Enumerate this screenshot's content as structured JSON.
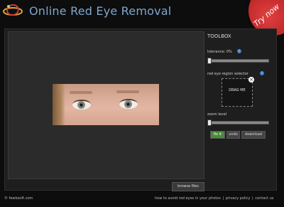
{
  "header": {
    "title": "Online Red Eye Removal",
    "logo_icon": "swirl-logo-icon",
    "try_now_label": "Try now"
  },
  "toolbox": {
    "title": "TOOLBOX",
    "tolerance_label": "tolerance: 0%",
    "tolerance_value": 0,
    "region_selector_label": "red eye region selector",
    "drag_me_label": "DRAG ME",
    "zoom_label": "zoom level",
    "buttons": {
      "fix_it": "fix it",
      "undo": "undo",
      "download": "download"
    }
  },
  "canvas": {
    "browse_label": "browse files"
  },
  "footer": {
    "copyright": "© fewbsoft.com",
    "links": [
      "how to avoid red eyes in your photos",
      "privacy policy",
      "contact us"
    ]
  },
  "colors": {
    "background": "#0d0d0d",
    "title": "#7fa6cf",
    "try_now": "#c62828",
    "fix_it": "#4a8a3c",
    "info": "#3a7fd0"
  }
}
